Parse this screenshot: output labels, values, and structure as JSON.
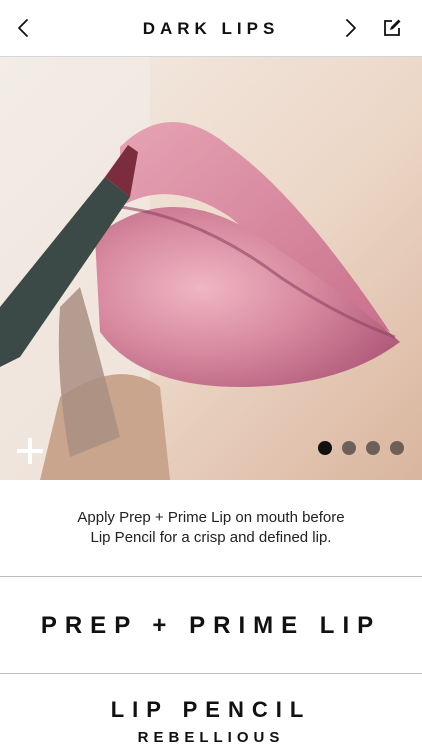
{
  "header": {
    "title": "DARK LIPS",
    "back_icon": "chevron-left-icon",
    "next_icon": "chevron-right-icon",
    "edit_icon": "edit-note-icon"
  },
  "hero": {
    "add_icon": "plus-icon",
    "pagination": {
      "total": 4,
      "active": 1
    }
  },
  "description": {
    "line1": "Apply Prep + Prime Lip on mouth before",
    "line2": "Lip Pencil for a crisp and defined lip."
  },
  "products": [
    {
      "name": "PREP + PRIME LIP"
    },
    {
      "name": "LIP PENCIL",
      "shade": "REBELLIOUS"
    }
  ],
  "colors": {
    "text": "#111111",
    "divider": "#bdbdbd",
    "lip": "#d27a95",
    "skin": "#ead3c1"
  }
}
